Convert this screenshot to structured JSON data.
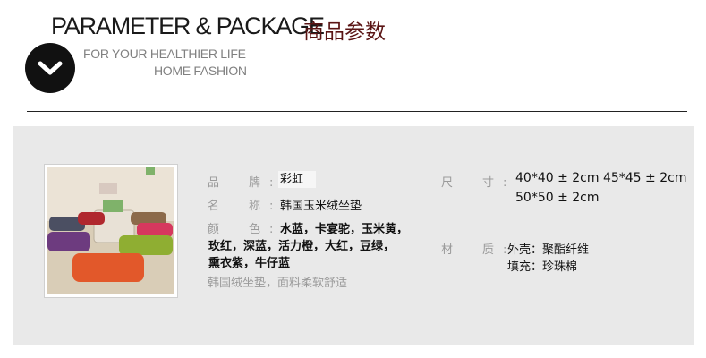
{
  "header": {
    "title_en": "PARAMETER & PACKAGE",
    "title_cn": "商品参数",
    "subtitle_line1": "FOR YOUR HEALTHIER LIFE",
    "subtitle_line2": "HOME FASHION",
    "icon": "chevron-down-circle-icon"
  },
  "specs": {
    "brand_label": "品　牌:",
    "brand_value": "彩虹",
    "name_label": "名　称:",
    "name_value": "韩国玉米绒坐垫",
    "color_label": "颜　色:",
    "color_value_line1": "水蓝，卡宴驼，玉米黄，",
    "color_value_line2": "玫红，深蓝，活力橙，大红，豆绿，",
    "color_value_line3": "熏衣紫，牛仔蓝",
    "size_label": "尺　寸:",
    "size_value_line1": "40*40 ± 2cm  45*45 ± 2cm",
    "size_value_line2": "50*50 ± 2cm",
    "material_label": "材　质:",
    "material_value_line1": "外壳：聚酯纤维",
    "material_value_line2": "填充：珍珠棉",
    "note": "韩国绒坐垫，面料柔软舒适"
  },
  "colors": {
    "title_cn": "#5a1414",
    "panel_bg": "#e9e9e9"
  }
}
